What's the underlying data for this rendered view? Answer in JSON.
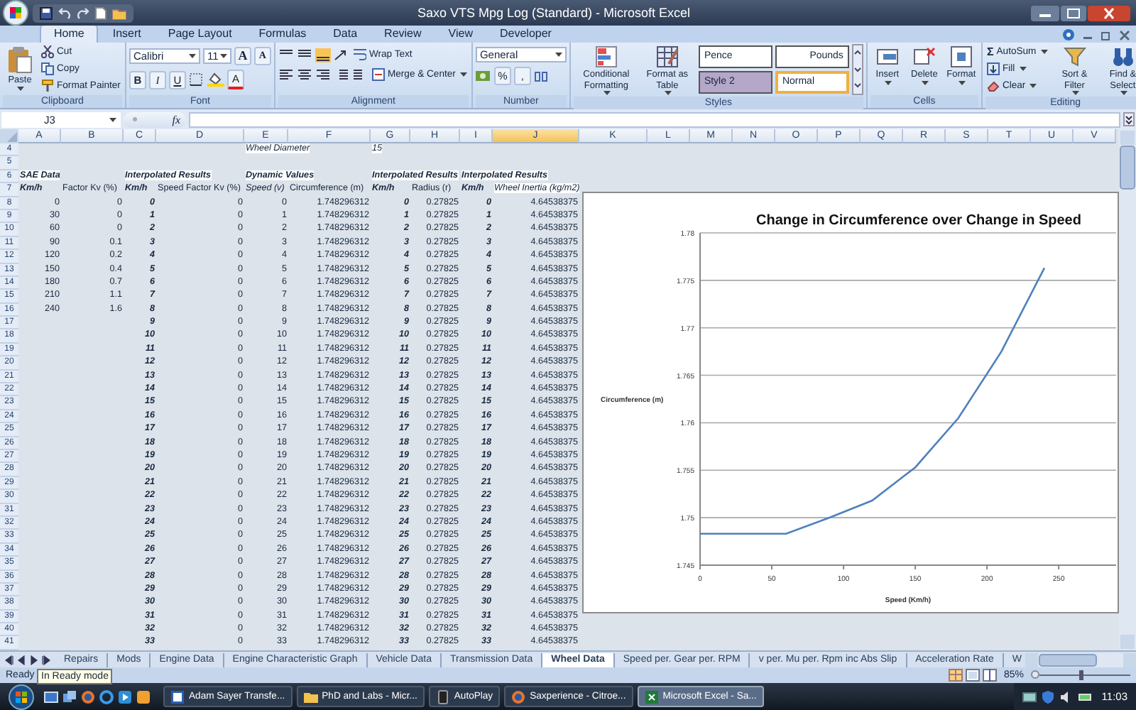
{
  "window": {
    "title": "Saxo VTS Mpg Log (Standard) - Microsoft Excel"
  },
  "ribbon": {
    "tabs": [
      {
        "label": "Home",
        "selected": true
      },
      {
        "label": "Insert",
        "selected": false
      },
      {
        "label": "Page Layout",
        "selected": false
      },
      {
        "label": "Formulas",
        "selected": false
      },
      {
        "label": "Data",
        "selected": false
      },
      {
        "label": "Review",
        "selected": false
      },
      {
        "label": "View",
        "selected": false
      },
      {
        "label": "Developer",
        "selected": false
      }
    ],
    "clipboard": {
      "label": "Clipboard",
      "paste": "Paste",
      "cut": "Cut",
      "copy": "Copy",
      "format_painter": "Format Painter"
    },
    "font": {
      "label": "Font",
      "name": "Calibri",
      "size": "11",
      "grow": "A",
      "shrink": "A",
      "bold": "B",
      "italic": "I",
      "underline": "U",
      "font_color_label": "A"
    },
    "alignment": {
      "label": "Alignment",
      "wrap": "Wrap Text",
      "merge": "Merge & Center"
    },
    "number": {
      "label": "Number",
      "format": "General",
      "percent": "%",
      "comma": ","
    },
    "styles": {
      "label": "Styles",
      "conditional": "Conditional Formatting",
      "table": "Format as Table",
      "gallery": [
        {
          "name": "Pence",
          "kind": "text",
          "color": "#ffffff",
          "selected": false
        },
        {
          "name": "Pounds",
          "kind": "currency",
          "color": "#ffffff",
          "selected": false
        },
        {
          "name": "Style 2",
          "kind": "text",
          "color": "#b4a7c8",
          "selected": false
        },
        {
          "name": "Normal",
          "kind": "text",
          "color": "#ffffff",
          "selected": true
        }
      ]
    },
    "cells": {
      "label": "Cells",
      "insert": "Insert",
      "delete": "Delete",
      "format": "Format"
    },
    "editing": {
      "label": "Editing",
      "sigma": "Σ",
      "autosum": "AutoSum",
      "fill": "Fill",
      "clear": "Clear",
      "sort": "Sort & Filter",
      "find": "Find & Select"
    }
  },
  "formula_bar": {
    "name_box": "J3",
    "function_label": "fx"
  },
  "columns": [
    {
      "label": "A",
      "selected": false
    },
    {
      "label": "B",
      "selected": false
    },
    {
      "label": "C",
      "selected": false
    },
    {
      "label": "D",
      "selected": false
    },
    {
      "label": "E",
      "selected": false
    },
    {
      "label": "F",
      "selected": false
    },
    {
      "label": "G",
      "selected": false
    },
    {
      "label": "H",
      "selected": false
    },
    {
      "label": "I",
      "selected": false
    },
    {
      "label": "J",
      "selected": true
    },
    {
      "label": "K",
      "selected": false
    },
    {
      "label": "L",
      "selected": false
    },
    {
      "label": "M",
      "selected": false
    },
    {
      "label": "N",
      "selected": false
    },
    {
      "label": "O",
      "selected": false
    },
    {
      "label": "P",
      "selected": false
    },
    {
      "label": "Q",
      "selected": false
    },
    {
      "label": "R",
      "selected": false
    },
    {
      "label": "S",
      "selected": false
    },
    {
      "label": "T",
      "selected": false
    },
    {
      "label": "U",
      "selected": false
    },
    {
      "label": "V",
      "selected": false
    }
  ],
  "rows": [
    {
      "number": "4",
      "kind": "title",
      "cells": [
        null,
        null,
        null,
        null,
        "Wheel Diameter",
        null,
        "15",
        null,
        null,
        null
      ]
    },
    {
      "number": "5",
      "kind": "blank",
      "cells": [
        null,
        null,
        null,
        null,
        null,
        null,
        null,
        null,
        null,
        null
      ]
    },
    {
      "number": "6",
      "kind": "group",
      "cells": [
        "SAE Data",
        null,
        "Interpolated Results",
        null,
        "Dynamic Values",
        null,
        "Interpolated Results",
        null,
        "Interpolated Results",
        null
      ]
    },
    {
      "number": "7",
      "kind": "header",
      "cells": [
        "Km/h",
        "Factor Kv (%)",
        "Km/h",
        "Speed Factor Kv (%)",
        "Speed (v)",
        "Circumference (m)",
        "Km/h",
        "Radius (r)",
        "Km/h",
        "Wheel Inertia (kg/m2)"
      ]
    },
    {
      "number": "8",
      "kind": "data",
      "cells": [
        "0",
        "0",
        "0",
        "0",
        "0",
        "1.748296312",
        "0",
        "0.27825",
        "0",
        "4.64538375"
      ]
    },
    {
      "number": "9",
      "kind": "data",
      "cells": [
        "30",
        "0",
        "1",
        "0",
        "1",
        "1.748296312",
        "1",
        "0.27825",
        "1",
        "4.64538375"
      ]
    },
    {
      "number": "10",
      "kind": "data",
      "cells": [
        "60",
        "0",
        "2",
        "0",
        "2",
        "1.748296312",
        "2",
        "0.27825",
        "2",
        "4.64538375"
      ]
    },
    {
      "number": "11",
      "kind": "data",
      "cells": [
        "90",
        "0.1",
        "3",
        "0",
        "3",
        "1.748296312",
        "3",
        "0.27825",
        "3",
        "4.64538375"
      ]
    },
    {
      "number": "12",
      "kind": "data",
      "cells": [
        "120",
        "0.2",
        "4",
        "0",
        "4",
        "1.748296312",
        "4",
        "0.27825",
        "4",
        "4.64538375"
      ]
    },
    {
      "number": "13",
      "kind": "data",
      "cells": [
        "150",
        "0.4",
        "5",
        "0",
        "5",
        "1.748296312",
        "5",
        "0.27825",
        "5",
        "4.64538375"
      ]
    },
    {
      "number": "14",
      "kind": "data",
      "cells": [
        "180",
        "0.7",
        "6",
        "0",
        "6",
        "1.748296312",
        "6",
        "0.27825",
        "6",
        "4.64538375"
      ]
    },
    {
      "number": "15",
      "kind": "data",
      "cells": [
        "210",
        "1.1",
        "7",
        "0",
        "7",
        "1.748296312",
        "7",
        "0.27825",
        "7",
        "4.64538375"
      ]
    },
    {
      "number": "16",
      "kind": "data",
      "cells": [
        "240",
        "1.6",
        "8",
        "0",
        "8",
        "1.748296312",
        "8",
        "0.27825",
        "8",
        "4.64538375"
      ]
    },
    {
      "number": "17",
      "kind": "data",
      "cells": [
        null,
        null,
        "9",
        "0",
        "9",
        "1.748296312",
        "9",
        "0.27825",
        "9",
        "4.64538375"
      ]
    },
    {
      "number": "18",
      "kind": "data",
      "cells": [
        null,
        null,
        "10",
        "0",
        "10",
        "1.748296312",
        "10",
        "0.27825",
        "10",
        "4.64538375"
      ]
    },
    {
      "number": "19",
      "kind": "data",
      "cells": [
        null,
        null,
        "11",
        "0",
        "11",
        "1.748296312",
        "11",
        "0.27825",
        "11",
        "4.64538375"
      ]
    },
    {
      "number": "20",
      "kind": "data",
      "cells": [
        null,
        null,
        "12",
        "0",
        "12",
        "1.748296312",
        "12",
        "0.27825",
        "12",
        "4.64538375"
      ]
    },
    {
      "number": "21",
      "kind": "data",
      "cells": [
        null,
        null,
        "13",
        "0",
        "13",
        "1.748296312",
        "13",
        "0.27825",
        "13",
        "4.64538375"
      ]
    },
    {
      "number": "22",
      "kind": "data",
      "cells": [
        null,
        null,
        "14",
        "0",
        "14",
        "1.748296312",
        "14",
        "0.27825",
        "14",
        "4.64538375"
      ]
    },
    {
      "number": "23",
      "kind": "data",
      "cells": [
        null,
        null,
        "15",
        "0",
        "15",
        "1.748296312",
        "15",
        "0.27825",
        "15",
        "4.64538375"
      ]
    },
    {
      "number": "24",
      "kind": "data",
      "cells": [
        null,
        null,
        "16",
        "0",
        "16",
        "1.748296312",
        "16",
        "0.27825",
        "16",
        "4.64538375"
      ]
    },
    {
      "number": "25",
      "kind": "data",
      "cells": [
        null,
        null,
        "17",
        "0",
        "17",
        "1.748296312",
        "17",
        "0.27825",
        "17",
        "4.64538375"
      ]
    },
    {
      "number": "26",
      "kind": "data",
      "cells": [
        null,
        null,
        "18",
        "0",
        "18",
        "1.748296312",
        "18",
        "0.27825",
        "18",
        "4.64538375"
      ]
    },
    {
      "number": "27",
      "kind": "data",
      "cells": [
        null,
        null,
        "19",
        "0",
        "19",
        "1.748296312",
        "19",
        "0.27825",
        "19",
        "4.64538375"
      ]
    },
    {
      "number": "28",
      "kind": "data",
      "cells": [
        null,
        null,
        "20",
        "0",
        "20",
        "1.748296312",
        "20",
        "0.27825",
        "20",
        "4.64538375"
      ]
    },
    {
      "number": "29",
      "kind": "data",
      "cells": [
        null,
        null,
        "21",
        "0",
        "21",
        "1.748296312",
        "21",
        "0.27825",
        "21",
        "4.64538375"
      ]
    },
    {
      "number": "30",
      "kind": "data",
      "cells": [
        null,
        null,
        "22",
        "0",
        "22",
        "1.748296312",
        "22",
        "0.27825",
        "22",
        "4.64538375"
      ]
    },
    {
      "number": "31",
      "kind": "data",
      "cells": [
        null,
        null,
        "23",
        "0",
        "23",
        "1.748296312",
        "23",
        "0.27825",
        "23",
        "4.64538375"
      ]
    },
    {
      "number": "32",
      "kind": "data",
      "cells": [
        null,
        null,
        "24",
        "0",
        "24",
        "1.748296312",
        "24",
        "0.27825",
        "24",
        "4.64538375"
      ]
    },
    {
      "number": "33",
      "kind": "data",
      "cells": [
        null,
        null,
        "25",
        "0",
        "25",
        "1.748296312",
        "25",
        "0.27825",
        "25",
        "4.64538375"
      ]
    },
    {
      "number": "34",
      "kind": "data",
      "cells": [
        null,
        null,
        "26",
        "0",
        "26",
        "1.748296312",
        "26",
        "0.27825",
        "26",
        "4.64538375"
      ]
    },
    {
      "number": "35",
      "kind": "data",
      "cells": [
        null,
        null,
        "27",
        "0",
        "27",
        "1.748296312",
        "27",
        "0.27825",
        "27",
        "4.64538375"
      ]
    },
    {
      "number": "36",
      "kind": "data",
      "cells": [
        null,
        null,
        "28",
        "0",
        "28",
        "1.748296312",
        "28",
        "0.27825",
        "28",
        "4.64538375"
      ]
    },
    {
      "number": "37",
      "kind": "data",
      "cells": [
        null,
        null,
        "29",
        "0",
        "29",
        "1.748296312",
        "29",
        "0.27825",
        "29",
        "4.64538375"
      ]
    },
    {
      "number": "38",
      "kind": "data",
      "cells": [
        null,
        null,
        "30",
        "0",
        "30",
        "1.748296312",
        "30",
        "0.27825",
        "30",
        "4.64538375"
      ]
    },
    {
      "number": "39",
      "kind": "data",
      "cells": [
        null,
        null,
        "31",
        "0",
        "31",
        "1.748296312",
        "31",
        "0.27825",
        "31",
        "4.64538375"
      ]
    },
    {
      "number": "40",
      "kind": "data",
      "cells": [
        null,
        null,
        "32",
        "0",
        "32",
        "1.748296312",
        "32",
        "0.27825",
        "32",
        "4.64538375"
      ]
    },
    {
      "number": "41",
      "kind": "data",
      "cells": [
        null,
        null,
        "33",
        "0",
        "33",
        "1.748296312",
        "33",
        "0.27825",
        "33",
        "4.64538375"
      ]
    }
  ],
  "chart": {
    "chart_data": {
      "type": "line",
      "title": "Change in Circumference over Change in Speed",
      "xlabel": "Speed (Km/h)",
      "ylabel": "Circumference (m)",
      "x": [
        0,
        30,
        60,
        90,
        120,
        150,
        180,
        210,
        240
      ],
      "series": [
        {
          "color": "#4f81bd",
          "values": [
            1.7483,
            1.7483,
            1.7483,
            1.75,
            1.7518,
            1.7553,
            1.7605,
            1.7675,
            1.7763
          ]
        }
      ],
      "xlim": [
        0,
        290
      ],
      "ylim": [
        1.745,
        1.78
      ],
      "grid": true,
      "xticks": [
        0,
        50,
        100,
        150,
        200,
        250
      ],
      "yticks": [
        1.745,
        1.75,
        1.755,
        1.76,
        1.765,
        1.77,
        1.775,
        1.78
      ]
    }
  },
  "sheet_tabs": [
    {
      "label": "Repairs",
      "selected": false
    },
    {
      "label": "Mods",
      "selected": false
    },
    {
      "label": "Engine Data",
      "selected": false
    },
    {
      "label": "Engine Characteristic Graph",
      "selected": false
    },
    {
      "label": "Vehicle Data",
      "selected": false
    },
    {
      "label": "Transmission Data",
      "selected": false
    },
    {
      "label": "Wheel Data",
      "selected": true
    },
    {
      "label": "Speed per. Gear per. RPM",
      "selected": false
    },
    {
      "label": "v per. Mu per. Rpm inc Abs Slip",
      "selected": false
    },
    {
      "label": "Acceleration Rate",
      "selected": false
    },
    {
      "label": "W",
      "selected": false
    }
  ],
  "status_bar": {
    "status": "Ready",
    "tooltip": "In Ready mode",
    "zoom": "85%",
    "level": 0.5
  },
  "taskbar": {
    "tasks": [
      {
        "label": "Adam Sayer Transfe...",
        "kind": "word",
        "selected": false
      },
      {
        "label": "PhD and Labs - Micr...",
        "kind": "folder",
        "selected": false
      },
      {
        "label": "AutoPlay",
        "kind": "device",
        "selected": false
      },
      {
        "label": "Saxperience - Citroe...",
        "kind": "browser",
        "selected": false
      },
      {
        "label": "Microsoft Excel - Sa...",
        "kind": "excel",
        "selected": true
      }
    ],
    "clock": "11:03"
  }
}
